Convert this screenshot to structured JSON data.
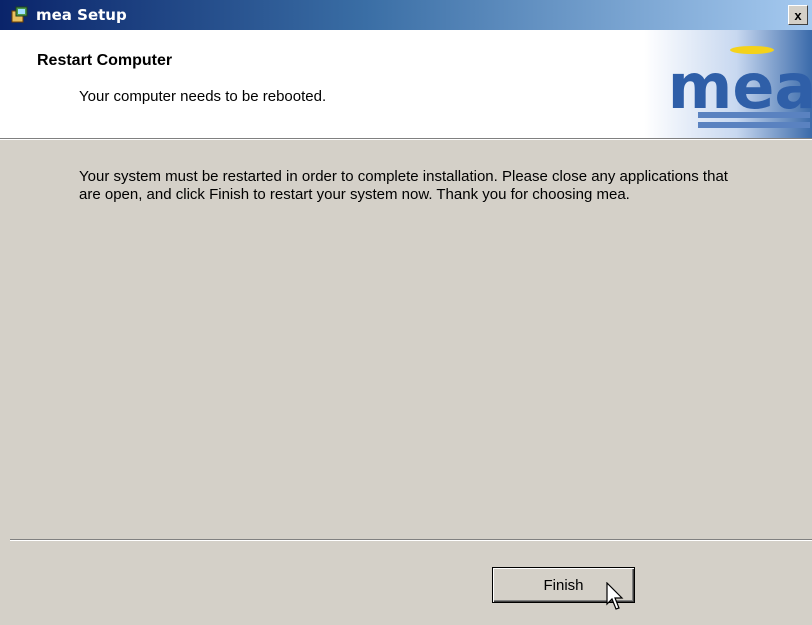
{
  "window": {
    "title": "mea Setup",
    "close_label": "x"
  },
  "header": {
    "title": "Restart Computer",
    "subtitle": "Your computer needs to be rebooted.",
    "logo_text": "mea"
  },
  "body": {
    "message": "Your system must be restarted in order to complete installation.  Please close any applications that are open, and click Finish to restart your system now.  Thank you for choosing mea."
  },
  "footer": {
    "finish_label": "Finish"
  },
  "colors": {
    "titlebar_start": "#0a246a",
    "titlebar_end": "#a6caf0",
    "window_bg": "#d4d0c8",
    "logo_blue": "#2f5fa8",
    "logo_yellow": "#f4d21a"
  },
  "icons": {
    "app": "setup-icon",
    "close": "close-icon",
    "cursor": "mouse-pointer-icon"
  }
}
